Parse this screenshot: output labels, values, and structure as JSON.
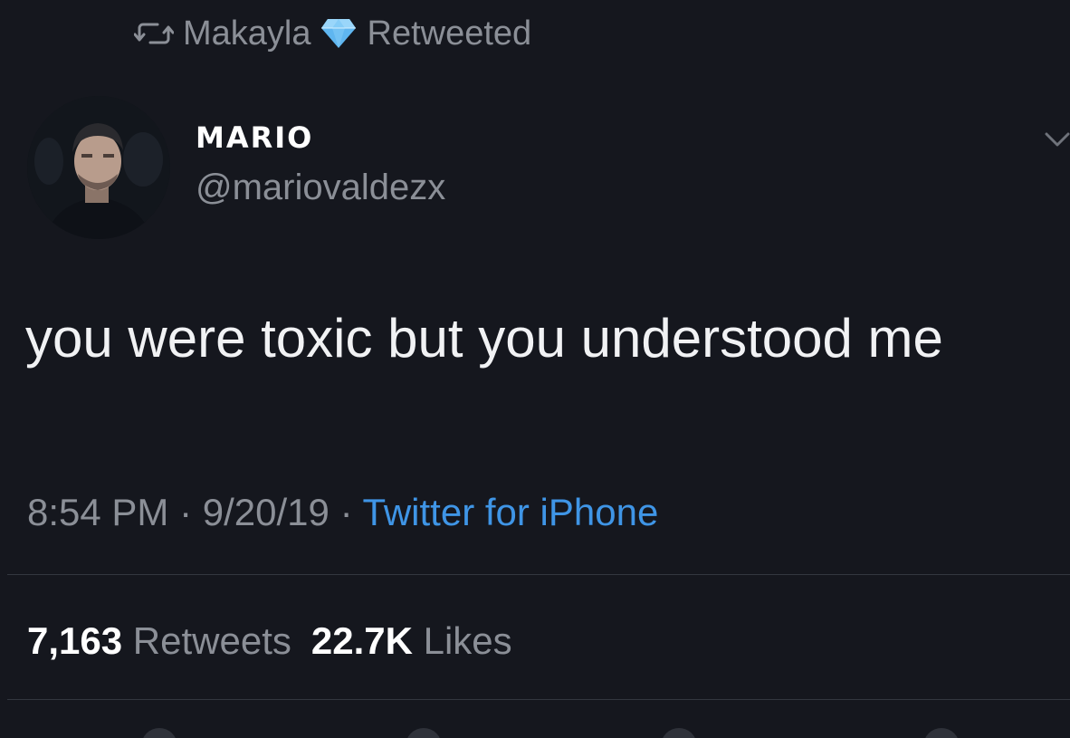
{
  "retweet_context": {
    "icon": "retweet-icon",
    "user": "Makayla",
    "badge_icon": "diamond-icon",
    "label": "Retweeted"
  },
  "author": {
    "name": "MARIO",
    "handle": "@mariovaldezx"
  },
  "tweet": {
    "text": "you were toxic but you understood me",
    "time": "8:54 PM",
    "separator": "·",
    "date": "9/20/19",
    "source": "Twitter for iPhone"
  },
  "stats": {
    "retweets_count": "7,163",
    "retweets_label": "Retweets",
    "likes_count": "22.7K",
    "likes_label": "Likes"
  },
  "colors": {
    "background": "#15171e",
    "secondary_text": "#8b8f97",
    "link": "#3f95e6",
    "diamond": "#5fb6f0"
  }
}
